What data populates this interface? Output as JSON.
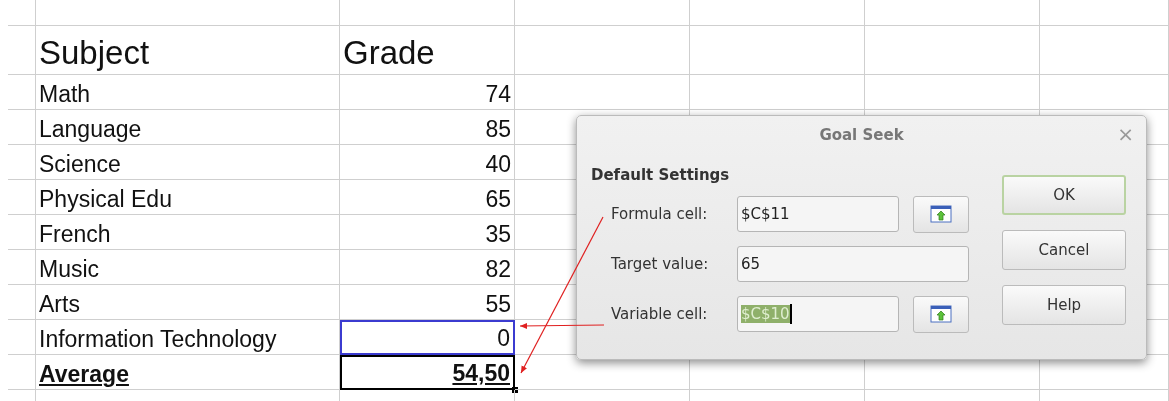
{
  "sheet": {
    "rows": [
      {
        "kind": "header",
        "subject": "Subject",
        "grade": "Grade",
        "referenced": false,
        "selected": false
      },
      {
        "kind": "item",
        "subject": "Math",
        "grade": "74",
        "referenced": false,
        "selected": false
      },
      {
        "kind": "item",
        "subject": "Language",
        "grade": "85",
        "referenced": false,
        "selected": false
      },
      {
        "kind": "item",
        "subject": "Science",
        "grade": "40",
        "referenced": false,
        "selected": false
      },
      {
        "kind": "item",
        "subject": "Physical Edu",
        "grade": "65",
        "referenced": false,
        "selected": false
      },
      {
        "kind": "item",
        "subject": "French",
        "grade": "35",
        "referenced": false,
        "selected": false
      },
      {
        "kind": "item",
        "subject": "Music",
        "grade": "82",
        "referenced": false,
        "selected": false
      },
      {
        "kind": "item",
        "subject": "Arts",
        "grade": "55",
        "referenced": false,
        "selected": false
      },
      {
        "kind": "item",
        "subject": "Information Technology",
        "grade": "0",
        "referenced": true,
        "selected": false
      },
      {
        "kind": "total",
        "subject": "Average",
        "grade": "54,50",
        "referenced": false,
        "selected": true
      }
    ]
  },
  "dialog": {
    "title": "Goal Seek",
    "close": "×",
    "section": "Default Settings",
    "fields": [
      {
        "label": "Formula cell:",
        "value": "$C$11",
        "picker": true,
        "text_selected": false
      },
      {
        "label": "Target value:",
        "value": "65",
        "picker": false,
        "text_selected": false
      },
      {
        "label": "Variable cell:",
        "value": "$C$10",
        "picker": true,
        "text_selected": true
      }
    ],
    "buttons": [
      {
        "label": "OK",
        "default": true
      },
      {
        "label": "Cancel",
        "default": false
      },
      {
        "label": "Help",
        "default": false
      }
    ]
  }
}
